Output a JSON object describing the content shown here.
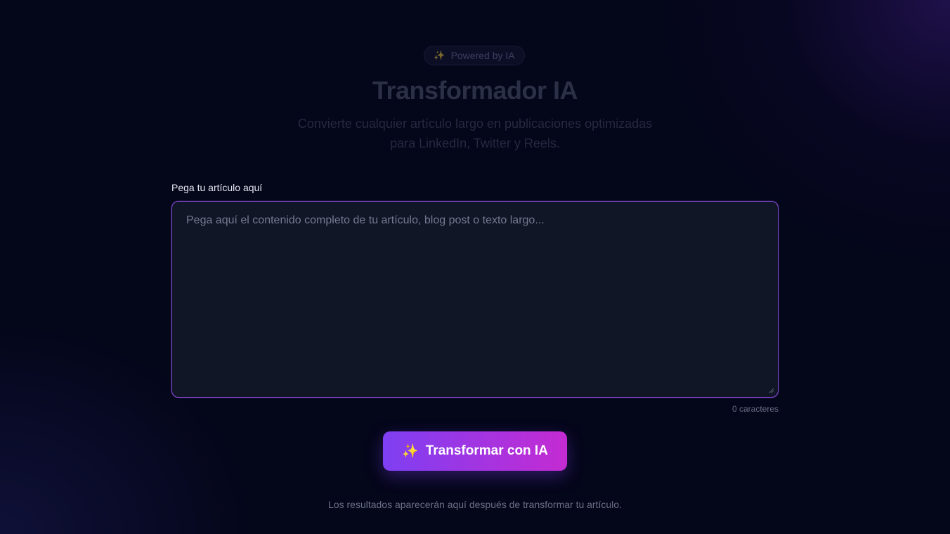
{
  "header": {
    "badge_icon": "sparkles-icon",
    "badge_text": "Powered by IA",
    "title": "Transformador IA",
    "subtitle_line1": "Convierte cualquier artículo largo en publicaciones optimizadas",
    "subtitle_line2": "para LinkedIn, Twitter y Reels."
  },
  "form": {
    "label": "Pega tu artículo aquí",
    "placeholder": "Pega aquí el contenido completo de tu artículo, blog post o texto largo...",
    "value": "",
    "char_count": "0 caracteres"
  },
  "action": {
    "icon": "sparkles-icon",
    "label": "Transformar con IA"
  },
  "results": {
    "note": "Los resultados aparecerán aquí después de transformar tu artículo."
  },
  "colors": {
    "background": "#04061a",
    "accent_start": "#7e3ff2",
    "accent_end": "#c42bd2",
    "textarea_border": "#8a4bdc"
  }
}
